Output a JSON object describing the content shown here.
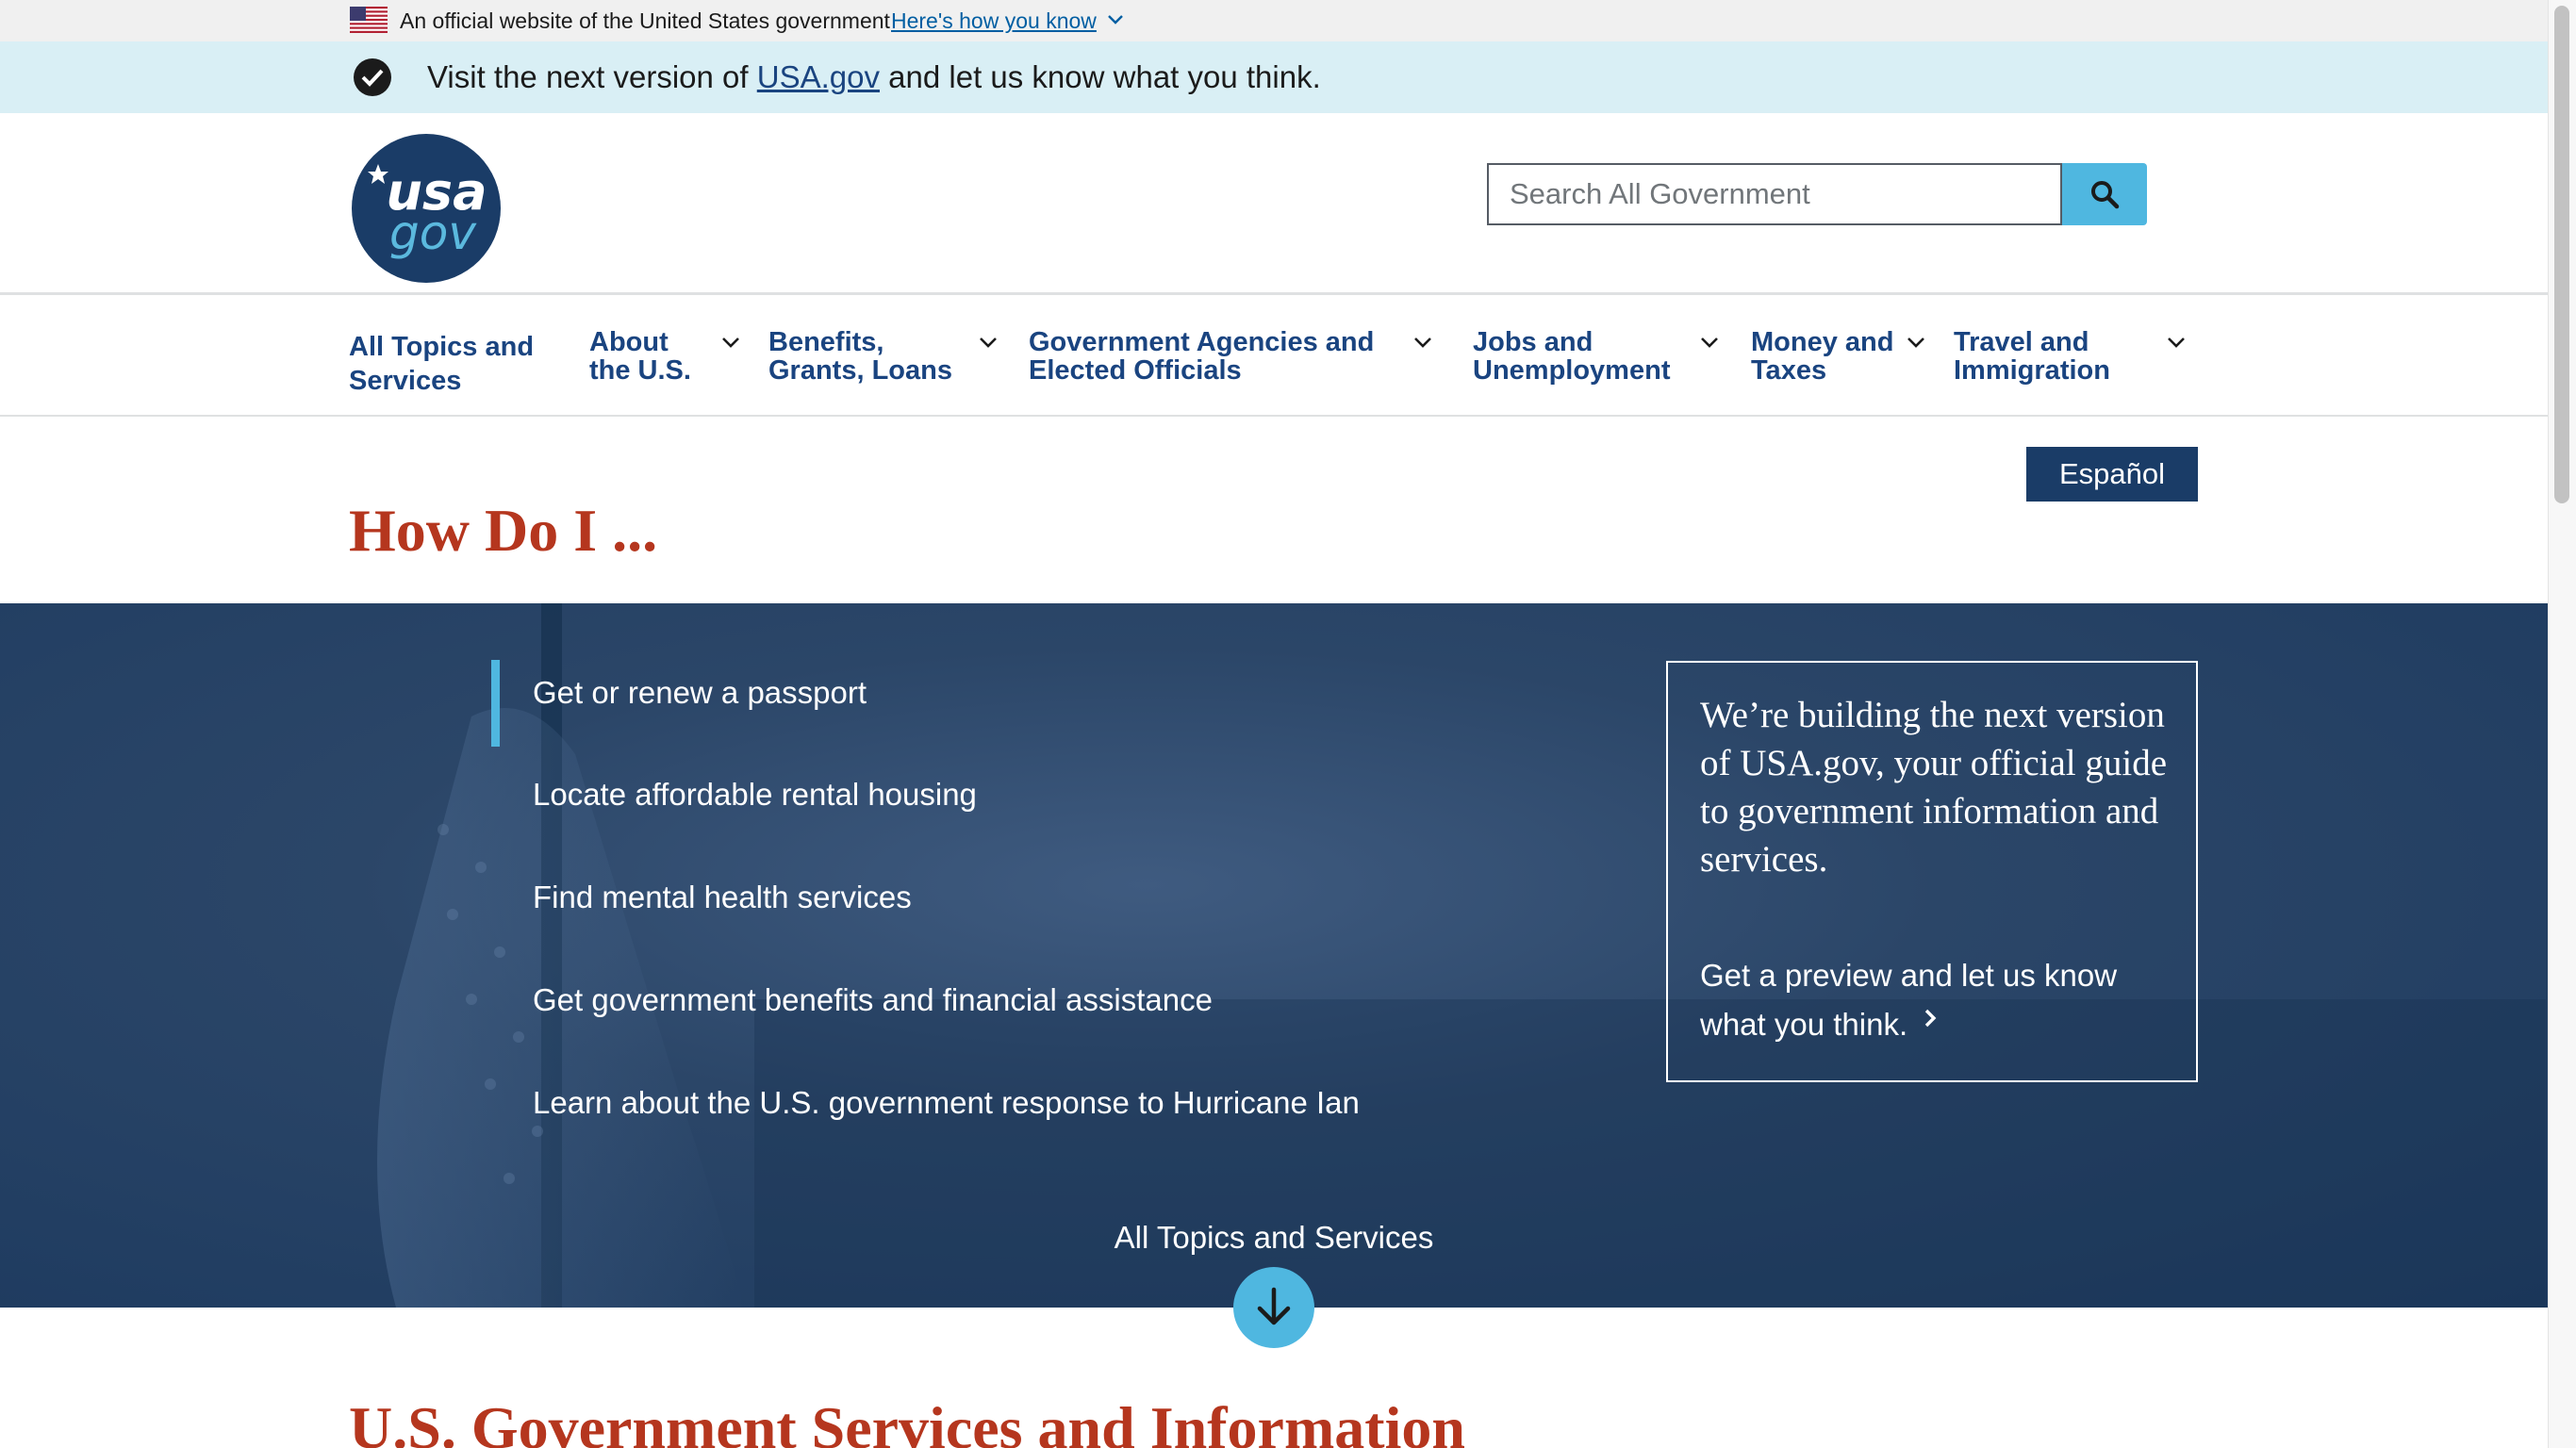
{
  "official_banner": {
    "text": "An official website of the United States government",
    "link": "Here's how you know"
  },
  "next_banner": {
    "prefix": "Visit the next version of ",
    "link": "USA.gov",
    "suffix": " and let us know what you think."
  },
  "header": {
    "logo_top": "usa",
    "logo_bottom": "gov",
    "search_placeholder": "Search All Government"
  },
  "nav": {
    "items": [
      {
        "line1": "All Topics and",
        "line2": "Services"
      },
      {
        "line1": "About",
        "line2": "the U.S."
      },
      {
        "line1": "Benefits,",
        "line2": "Grants, Loans"
      },
      {
        "line1": "Government Agencies and",
        "line2": "Elected Officials"
      },
      {
        "line1": "Jobs and",
        "line2": "Unemployment"
      },
      {
        "line1": "Money and",
        "line2": "Taxes"
      },
      {
        "line1": "Travel and",
        "line2": "Immigration"
      }
    ]
  },
  "language_button": "Español",
  "how_title": "How Do I ...",
  "how_to": [
    "Get or renew a passport",
    "Locate affordable rental housing",
    "Find mental health services",
    "Get government benefits and financial assistance",
    "Learn about the U.S. government response to Hurricane Ian"
  ],
  "promo": {
    "headline": "We’re building the next version of USA.gov, your official guide to government information and services.",
    "cta": "Get a preview and let us know what you think."
  },
  "all_topics_label": "All Topics and Services",
  "section_title": "U.S. Government Services and Information",
  "colors": {
    "navy": "#1a4480",
    "hero": "#1d3a5f",
    "accent_blue": "#4fb7e0",
    "title_red": "#b5361e",
    "banner_bg": "#d9eff5"
  }
}
